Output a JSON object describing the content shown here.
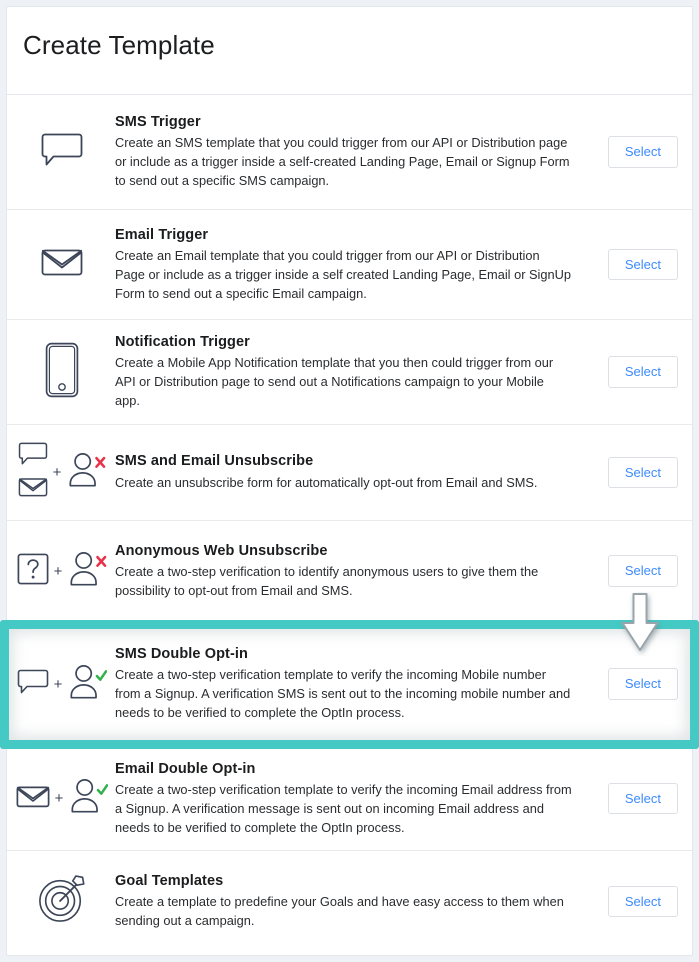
{
  "header": {
    "title": "Create Template"
  },
  "select_label": "Select",
  "rows": [
    {
      "icon": "speech-bubble-icon",
      "title": "SMS Trigger",
      "desc": "Create an SMS template that you could trigger from our API or Distribution page or include as a trigger inside a self-created Landing Page, Email or Signup Form to send out a specific SMS campaign.",
      "action": "Select"
    },
    {
      "icon": "envelope-icon",
      "title": "Email Trigger",
      "desc": "Create an Email template that you could trigger from our API or Distribution Page or include as a trigger inside a self created Landing Page, Email or SignUp Form to send out a specific Email campaign.",
      "action": "Select"
    },
    {
      "icon": "mobile-phone-icon",
      "title": "Notification Trigger",
      "desc": "Create a Mobile App Notification template that you then could trigger from our API or Distribution page to send out a Notifications campaign to your Mobile app.",
      "action": "Select"
    },
    {
      "icon": "speech-bubble-and-envelope-plus-person-x-icon",
      "title": "SMS and Email Unsubscribe",
      "desc": "Create an unsubscribe form for automatically opt-out from Email and SMS.",
      "action": "Select"
    },
    {
      "icon": "question-box-plus-person-x-icon",
      "title": "Anonymous Web Unsubscribe",
      "desc": "Create a two-step verification to identify anonymous users to give them the possibility to opt-out from Email and SMS.",
      "action": "Select"
    },
    {
      "icon": "speech-bubble-plus-person-check-icon",
      "title": "SMS Double Opt-in",
      "desc": "Create a two-step verification template to verify the incoming Mobile number from a Signup. A verification SMS is sent out to the incoming mobile number and needs to be verified to complete the OptIn process.",
      "action": "Select",
      "highlighted": true
    },
    {
      "icon": "envelope-plus-person-check-icon",
      "title": "Email Double Opt-in",
      "desc": "Create a two-step verification template to verify the incoming Email address from a Signup. A verification message is sent out on incoming Email address and needs to be verified to complete the OptIn process.",
      "action": "Select"
    },
    {
      "icon": "target-dart-icon",
      "title": "Goal Templates",
      "desc": "Create a template to predefine your Goals and have easy access to them when sending out a campaign.",
      "action": "Select"
    }
  ],
  "annotations": {
    "highlight_color": "#45c9c4",
    "arrow": "down-arrow-annotation",
    "arrow_target": "SMS Double Opt-in"
  },
  "colors": {
    "accent_link": "#3d8bfd",
    "icon_stroke": "#3c4658",
    "badge_x": "#e8324a",
    "badge_check": "#2fb14b",
    "page_background": "#eef1f5"
  }
}
